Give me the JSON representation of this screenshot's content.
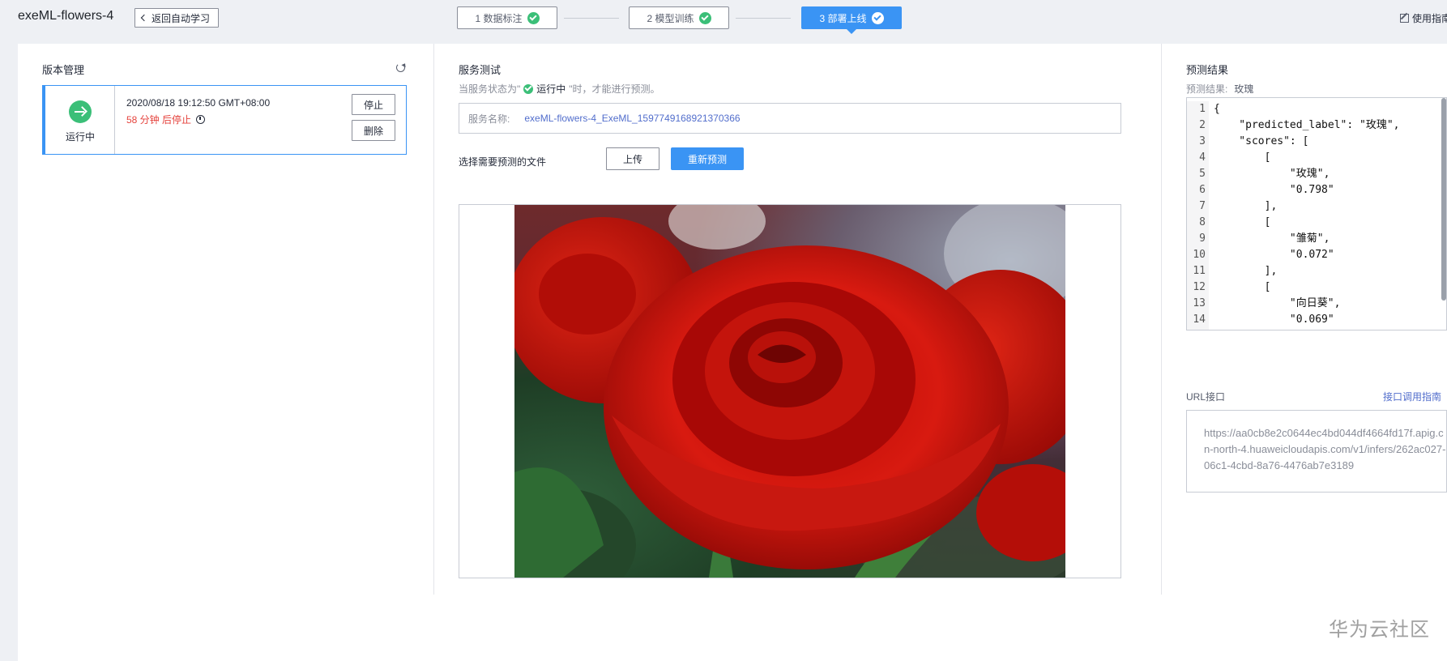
{
  "header": {
    "title": "exeML-flowers-4",
    "back_label": "返回自动学习",
    "steps": [
      {
        "label": "1 数据标注",
        "done": true
      },
      {
        "label": "2 模型训练",
        "done": true
      },
      {
        "label": "3 部署上线",
        "done": true,
        "active": true
      }
    ],
    "guide_label": "使用指南"
  },
  "version_panel": {
    "title": "版本管理",
    "status": "运行中",
    "created_time": "2020/08/18 19:12:50 GMT+08:00",
    "stop_countdown": "58 分钟 后停止",
    "stop_button": "停止",
    "delete_button": "删除"
  },
  "service_test": {
    "title": "服务测试",
    "hint_prefix": "当服务状态为\"",
    "hint_status": "运行中",
    "hint_suffix": "\"时，才能进行预测。",
    "service_name_label": "服务名称:",
    "service_name": "exeML-flowers-4_ExeML_1597749168921370366",
    "file_label": "选择需要预测的文件",
    "upload_button": "上传",
    "predict_button": "重新预测"
  },
  "prediction": {
    "title": "预测结果",
    "result_label": "预测结果:",
    "result_value": "玫瑰",
    "code_lines": [
      "{",
      "    \"predicted_label\": \"玫瑰\",",
      "    \"scores\": [",
      "        [",
      "            \"玫瑰\",",
      "            \"0.798\"",
      "        ],",
      "        [",
      "            \"雏菊\",",
      "            \"0.072\"",
      "        ],",
      "        [",
      "            \"向日葵\",",
      "            \"0.069\"",
      "        ],",
      "        ["
    ],
    "url_label": "URL接口",
    "api_guide_link": "接口调用指南",
    "url": "https://aa0cb8e2c0644ec4bd044df4664fd17f.apig.cn-north-4.huaweicloudapis.com/v1/infers/262ac027-06c1-4cbd-8a76-4476ab7e3189"
  },
  "watermark": "华为云社区",
  "colors": {
    "primary": "#3a94f4",
    "success": "#3bbf78",
    "danger": "#e5423c",
    "link": "#526ecc"
  }
}
